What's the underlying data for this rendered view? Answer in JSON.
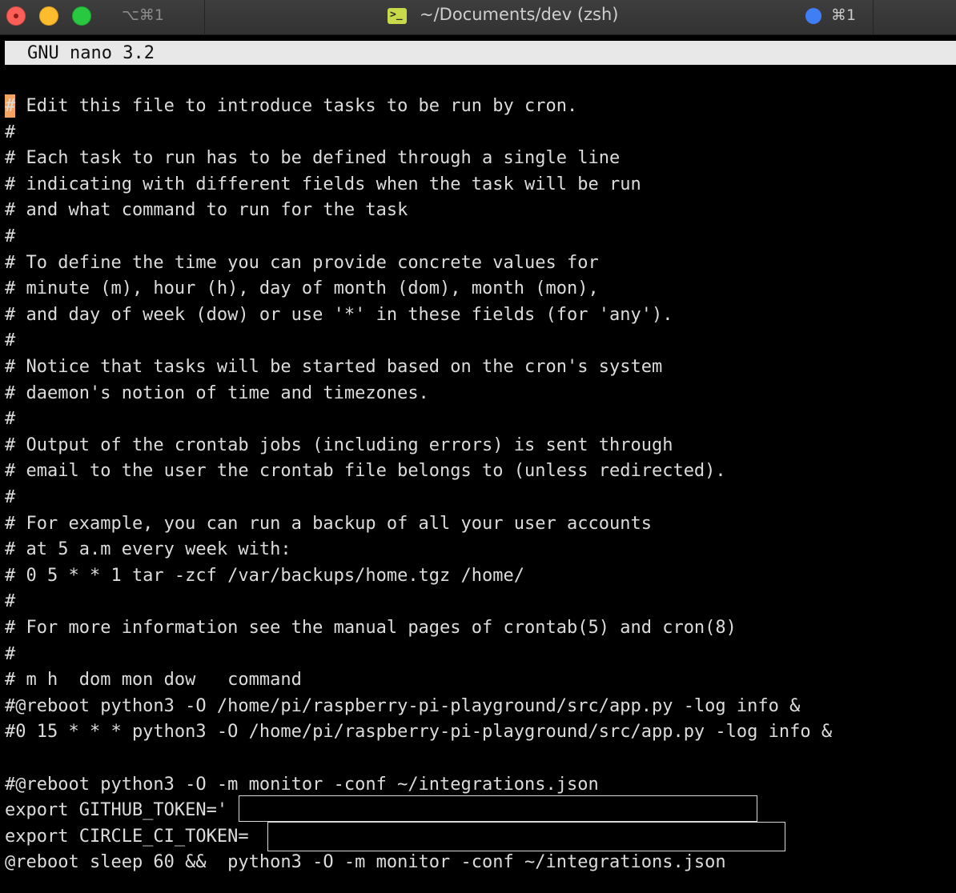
{
  "titlebar": {
    "shortcut_left": "⌥⌘1",
    "window_title": "~/Documents/dev (zsh)",
    "shortcut_right": "⌘1",
    "icons": [
      "close-icon",
      "minimize-icon",
      "maximize-icon",
      "terminal-icon",
      "tab-indicator-icon"
    ],
    "colors": {
      "close": "#fc5f57",
      "minimize": "#fdbc2e",
      "maximize": "#28c840",
      "terminal_icon": "#c8d94a",
      "tab_dot": "#3f7ef5"
    }
  },
  "nano": {
    "header": "GNU nano 3.2",
    "cursor_color": "#f4a460"
  },
  "editor": {
    "lines": [
      "# Edit this file to introduce tasks to be run by cron.",
      "#",
      "# Each task to run has to be defined through a single line",
      "# indicating with different fields when the task will be run",
      "# and what command to run for the task",
      "#",
      "# To define the time you can provide concrete values for",
      "# minute (m), hour (h), day of month (dom), month (mon),",
      "# and day of week (dow) or use '*' in these fields (for 'any').",
      "#",
      "# Notice that tasks will be started based on the cron's system",
      "# daemon's notion of time and timezones.",
      "#",
      "# Output of the crontab jobs (including errors) is sent through",
      "# email to the user the crontab file belongs to (unless redirected).",
      "#",
      "# For example, you can run a backup of all your user accounts",
      "# at 5 a.m every week with:",
      "# 0 5 * * 1 tar -zcf /var/backups/home.tgz /home/",
      "#",
      "# For more information see the manual pages of crontab(5) and cron(8)",
      "#",
      "# m h  dom mon dow   command",
      "#@reboot python3 -O /home/pi/raspberry-pi-playground/src/app.py -log info &",
      "#0 15 * * * python3 -O /home/pi/raspberry-pi-playground/src/app.py -log info &",
      "",
      "#@reboot python3 -O -m monitor -conf ~/integrations.json",
      "export GITHUB_TOKEN='",
      "export CIRCLE_CI_TOKEN=",
      "@reboot sleep 60 &&  python3 -O -m monitor -conf ~/integrations.json"
    ]
  }
}
